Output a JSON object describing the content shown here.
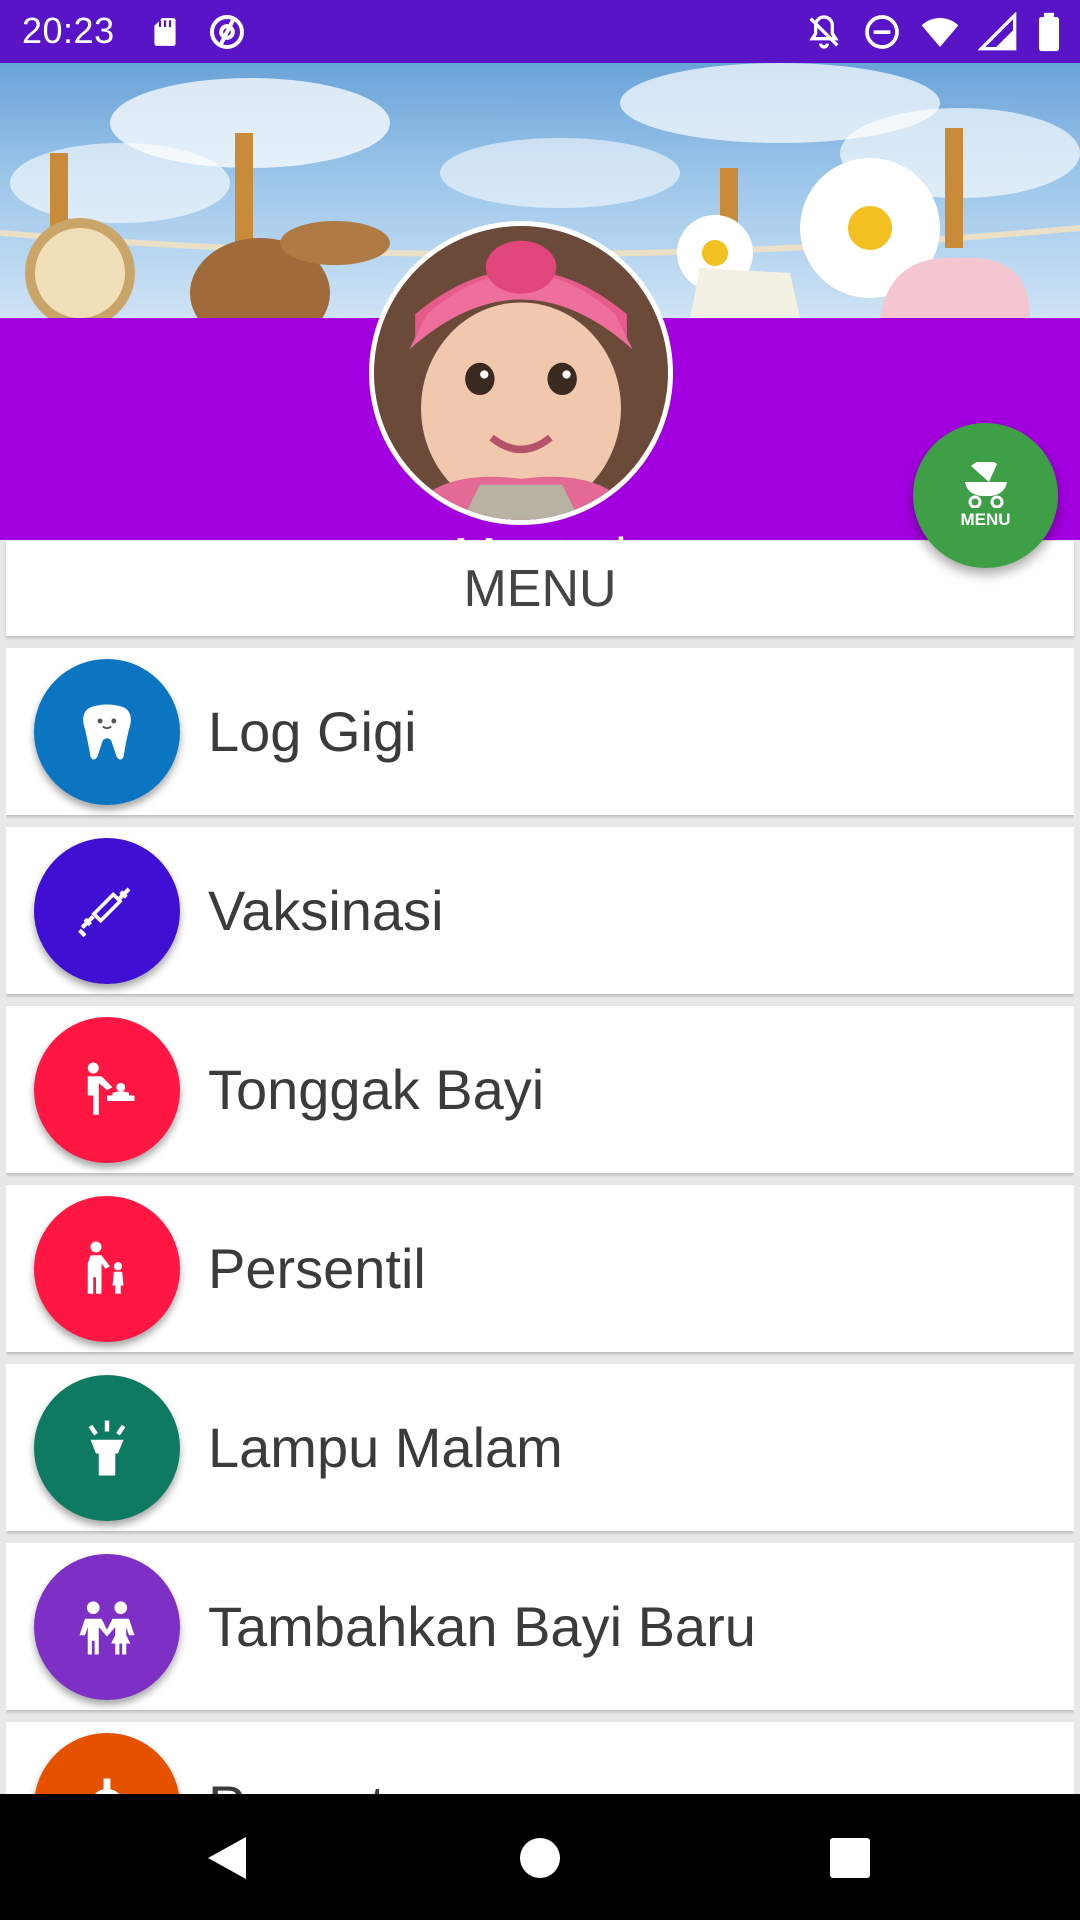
{
  "status_bar": {
    "time": "20:23",
    "left_icons": [
      "sd-card-icon",
      "at-sign-icon"
    ],
    "right_icons": [
      "notifications-off-icon",
      "do-not-disturb-icon",
      "wifi-icon",
      "signal-icon",
      "battery-icon"
    ],
    "background": "#5a14c8"
  },
  "profile": {
    "name": "Mentari",
    "header_color": "#a300e0"
  },
  "fab": {
    "label": "MENU",
    "icon": "baby-stroller-icon",
    "color": "#3f9f46"
  },
  "menu": {
    "title": "MENU",
    "items": [
      {
        "label": "Log Gigi",
        "icon": "tooth-icon",
        "color": "#0b75c2"
      },
      {
        "label": "Vaksinasi",
        "icon": "syringe-icon",
        "color": "#3f0fd3"
      },
      {
        "label": "Tonggak Bayi",
        "icon": "baby-changing-icon",
        "color": "#ff1744"
      },
      {
        "label": "Persentil",
        "icon": "parent-child-icon",
        "color": "#ff1744"
      },
      {
        "label": "Lampu Malam",
        "icon": "flashlight-icon",
        "color": "#0f7a62"
      },
      {
        "label": "Tambahkan Bayi Baru",
        "icon": "children-icon",
        "color": "#7e2fc6"
      },
      {
        "label": "Pengaturan",
        "icon": "settings-icon",
        "color": "#e65100"
      }
    ]
  },
  "nav_bar": {
    "buttons": [
      "back-icon",
      "home-icon",
      "recents-icon"
    ]
  }
}
